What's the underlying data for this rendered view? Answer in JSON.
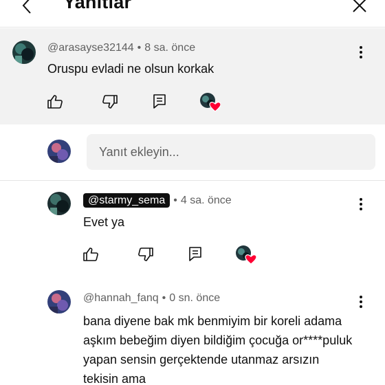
{
  "header": {
    "title": "Yanıtlar",
    "back_icon": "chevron-left-icon",
    "close_icon": "close-icon"
  },
  "parent_comment": {
    "author": "@arasayse32144",
    "separator": "•",
    "time": "8 sa. önce",
    "text": "Oruspu evladi ne olsun korkak"
  },
  "reply_box": {
    "placeholder": "Yanıt ekleyin..."
  },
  "replies": [
    {
      "author": "@starmy_sema",
      "separator": "•",
      "time": "4 sa. önce",
      "text": "Evet ya"
    },
    {
      "author": "@hannah_fanq",
      "separator": "•",
      "time": "0 sn. önce",
      "text": "bana diyene bak mk benmiyim bir koreli adama aşkım bebeğim diyen bildiğim çocuğa or****puluk yapan sensin gerçektende utanmaz arsızın tekisin ama"
    }
  ],
  "colors": {
    "heart": "#ff0033",
    "pill_bg": "#0f0f0f",
    "highlight_bg": "#f2f2f2",
    "meta_text": "#606060"
  }
}
